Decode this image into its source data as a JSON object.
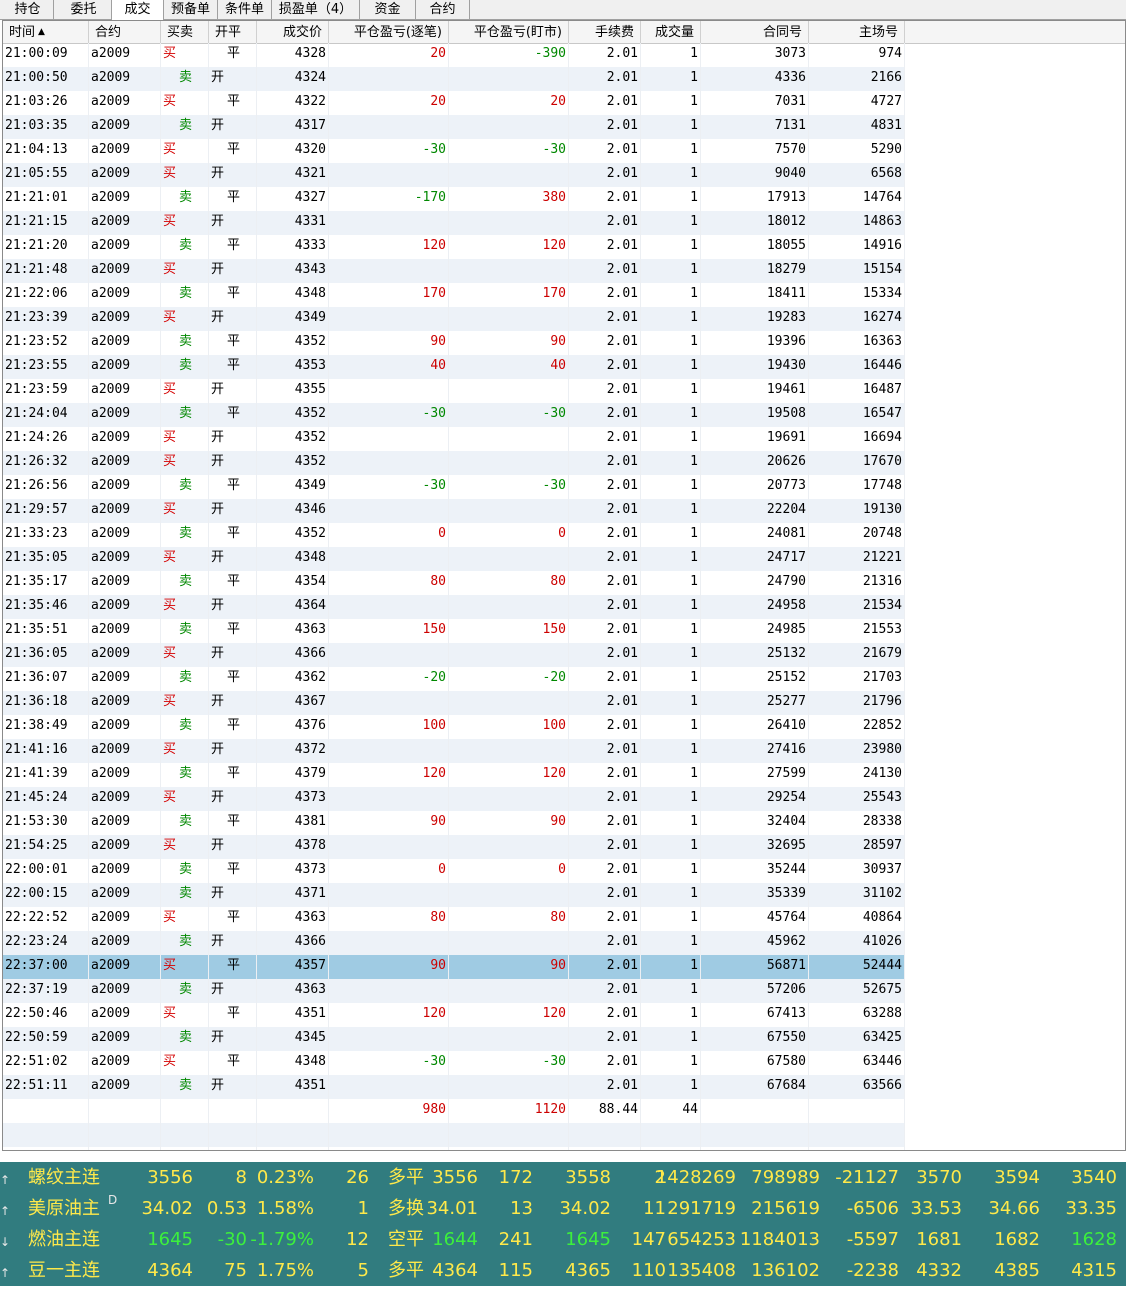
{
  "tabs": [
    {
      "label": "持仓",
      "active": false
    },
    {
      "label": "委托",
      "active": false
    },
    {
      "label": "成交",
      "active": true
    },
    {
      "label": "预备单",
      "active": false
    },
    {
      "label": "条件单",
      "active": false
    },
    {
      "label": "损盈单（4）",
      "active": false
    },
    {
      "label": "资金",
      "active": false
    },
    {
      "label": "合约",
      "active": false
    }
  ],
  "table": {
    "sort_indicator": "▲",
    "headers": {
      "time": "时间",
      "contract": "合约",
      "side": "买卖",
      "open_close": "开平",
      "price": "成交价",
      "pnl_trade": "平仓盈亏(逐笔)",
      "pnl_mtm": "平仓盈亏(盯市)",
      "fee": "手续费",
      "qty": "成交量",
      "contract_no": "合同号",
      "exchange_no": "主场号"
    },
    "rows": [
      {
        "time": "21:00:09",
        "contract": "a2009",
        "side": "买",
        "oc": "平",
        "price": "4328",
        "pnl_trade": "20",
        "pnl_mtm": "-390",
        "fee": "2.01",
        "qty": "1",
        "contract_no": "3073",
        "exchange_no": "974"
      },
      {
        "time": "21:00:50",
        "contract": "a2009",
        "side": "卖",
        "oc": "开",
        "price": "4324",
        "pnl_trade": "",
        "pnl_mtm": "",
        "fee": "2.01",
        "qty": "1",
        "contract_no": "4336",
        "exchange_no": "2166"
      },
      {
        "time": "21:03:26",
        "contract": "a2009",
        "side": "买",
        "oc": "平",
        "price": "4322",
        "pnl_trade": "20",
        "pnl_mtm": "20",
        "fee": "2.01",
        "qty": "1",
        "contract_no": "7031",
        "exchange_no": "4727"
      },
      {
        "time": "21:03:35",
        "contract": "a2009",
        "side": "卖",
        "oc": "开",
        "price": "4317",
        "pnl_trade": "",
        "pnl_mtm": "",
        "fee": "2.01",
        "qty": "1",
        "contract_no": "7131",
        "exchange_no": "4831"
      },
      {
        "time": "21:04:13",
        "contract": "a2009",
        "side": "买",
        "oc": "平",
        "price": "4320",
        "pnl_trade": "-30",
        "pnl_mtm": "-30",
        "fee": "2.01",
        "qty": "1",
        "contract_no": "7570",
        "exchange_no": "5290"
      },
      {
        "time": "21:05:55",
        "contract": "a2009",
        "side": "买",
        "oc": "开",
        "price": "4321",
        "pnl_trade": "",
        "pnl_mtm": "",
        "fee": "2.01",
        "qty": "1",
        "contract_no": "9040",
        "exchange_no": "6568"
      },
      {
        "time": "21:21:01",
        "contract": "a2009",
        "side": "卖",
        "oc": "平",
        "price": "4327",
        "pnl_trade": "-170",
        "pnl_mtm": "380",
        "fee": "2.01",
        "qty": "1",
        "contract_no": "17913",
        "exchange_no": "14764"
      },
      {
        "time": "21:21:15",
        "contract": "a2009",
        "side": "买",
        "oc": "开",
        "price": "4331",
        "pnl_trade": "",
        "pnl_mtm": "",
        "fee": "2.01",
        "qty": "1",
        "contract_no": "18012",
        "exchange_no": "14863"
      },
      {
        "time": "21:21:20",
        "contract": "a2009",
        "side": "卖",
        "oc": "平",
        "price": "4333",
        "pnl_trade": "120",
        "pnl_mtm": "120",
        "fee": "2.01",
        "qty": "1",
        "contract_no": "18055",
        "exchange_no": "14916"
      },
      {
        "time": "21:21:48",
        "contract": "a2009",
        "side": "买",
        "oc": "开",
        "price": "4343",
        "pnl_trade": "",
        "pnl_mtm": "",
        "fee": "2.01",
        "qty": "1",
        "contract_no": "18279",
        "exchange_no": "15154"
      },
      {
        "time": "21:22:06",
        "contract": "a2009",
        "side": "卖",
        "oc": "平",
        "price": "4348",
        "pnl_trade": "170",
        "pnl_mtm": "170",
        "fee": "2.01",
        "qty": "1",
        "contract_no": "18411",
        "exchange_no": "15334"
      },
      {
        "time": "21:23:39",
        "contract": "a2009",
        "side": "买",
        "oc": "开",
        "price": "4349",
        "pnl_trade": "",
        "pnl_mtm": "",
        "fee": "2.01",
        "qty": "1",
        "contract_no": "19283",
        "exchange_no": "16274"
      },
      {
        "time": "21:23:52",
        "contract": "a2009",
        "side": "卖",
        "oc": "平",
        "price": "4352",
        "pnl_trade": "90",
        "pnl_mtm": "90",
        "fee": "2.01",
        "qty": "1",
        "contract_no": "19396",
        "exchange_no": "16363"
      },
      {
        "time": "21:23:55",
        "contract": "a2009",
        "side": "卖",
        "oc": "平",
        "price": "4353",
        "pnl_trade": "40",
        "pnl_mtm": "40",
        "fee": "2.01",
        "qty": "1",
        "contract_no": "19430",
        "exchange_no": "16446"
      },
      {
        "time": "21:23:59",
        "contract": "a2009",
        "side": "买",
        "oc": "开",
        "price": "4355",
        "pnl_trade": "",
        "pnl_mtm": "",
        "fee": "2.01",
        "qty": "1",
        "contract_no": "19461",
        "exchange_no": "16487"
      },
      {
        "time": "21:24:04",
        "contract": "a2009",
        "side": "卖",
        "oc": "平",
        "price": "4352",
        "pnl_trade": "-30",
        "pnl_mtm": "-30",
        "fee": "2.01",
        "qty": "1",
        "contract_no": "19508",
        "exchange_no": "16547"
      },
      {
        "time": "21:24:26",
        "contract": "a2009",
        "side": "买",
        "oc": "开",
        "price": "4352",
        "pnl_trade": "",
        "pnl_mtm": "",
        "fee": "2.01",
        "qty": "1",
        "contract_no": "19691",
        "exchange_no": "16694"
      },
      {
        "time": "21:26:32",
        "contract": "a2009",
        "side": "买",
        "oc": "开",
        "price": "4352",
        "pnl_trade": "",
        "pnl_mtm": "",
        "fee": "2.01",
        "qty": "1",
        "contract_no": "20626",
        "exchange_no": "17670"
      },
      {
        "time": "21:26:56",
        "contract": "a2009",
        "side": "卖",
        "oc": "平",
        "price": "4349",
        "pnl_trade": "-30",
        "pnl_mtm": "-30",
        "fee": "2.01",
        "qty": "1",
        "contract_no": "20773",
        "exchange_no": "17748"
      },
      {
        "time": "21:29:57",
        "contract": "a2009",
        "side": "买",
        "oc": "开",
        "price": "4346",
        "pnl_trade": "",
        "pnl_mtm": "",
        "fee": "2.01",
        "qty": "1",
        "contract_no": "22204",
        "exchange_no": "19130"
      },
      {
        "time": "21:33:23",
        "contract": "a2009",
        "side": "卖",
        "oc": "平",
        "price": "4352",
        "pnl_trade": "0",
        "pnl_mtm": "0",
        "fee": "2.01",
        "qty": "1",
        "contract_no": "24081",
        "exchange_no": "20748"
      },
      {
        "time": "21:35:05",
        "contract": "a2009",
        "side": "买",
        "oc": "开",
        "price": "4348",
        "pnl_trade": "",
        "pnl_mtm": "",
        "fee": "2.01",
        "qty": "1",
        "contract_no": "24717",
        "exchange_no": "21221"
      },
      {
        "time": "21:35:17",
        "contract": "a2009",
        "side": "卖",
        "oc": "平",
        "price": "4354",
        "pnl_trade": "80",
        "pnl_mtm": "80",
        "fee": "2.01",
        "qty": "1",
        "contract_no": "24790",
        "exchange_no": "21316"
      },
      {
        "time": "21:35:46",
        "contract": "a2009",
        "side": "买",
        "oc": "开",
        "price": "4364",
        "pnl_trade": "",
        "pnl_mtm": "",
        "fee": "2.01",
        "qty": "1",
        "contract_no": "24958",
        "exchange_no": "21534"
      },
      {
        "time": "21:35:51",
        "contract": "a2009",
        "side": "卖",
        "oc": "平",
        "price": "4363",
        "pnl_trade": "150",
        "pnl_mtm": "150",
        "fee": "2.01",
        "qty": "1",
        "contract_no": "24985",
        "exchange_no": "21553"
      },
      {
        "time": "21:36:05",
        "contract": "a2009",
        "side": "买",
        "oc": "开",
        "price": "4366",
        "pnl_trade": "",
        "pnl_mtm": "",
        "fee": "2.01",
        "qty": "1",
        "contract_no": "25132",
        "exchange_no": "21679"
      },
      {
        "time": "21:36:07",
        "contract": "a2009",
        "side": "卖",
        "oc": "平",
        "price": "4362",
        "pnl_trade": "-20",
        "pnl_mtm": "-20",
        "fee": "2.01",
        "qty": "1",
        "contract_no": "25152",
        "exchange_no": "21703"
      },
      {
        "time": "21:36:18",
        "contract": "a2009",
        "side": "买",
        "oc": "开",
        "price": "4367",
        "pnl_trade": "",
        "pnl_mtm": "",
        "fee": "2.01",
        "qty": "1",
        "contract_no": "25277",
        "exchange_no": "21796"
      },
      {
        "time": "21:38:49",
        "contract": "a2009",
        "side": "卖",
        "oc": "平",
        "price": "4376",
        "pnl_trade": "100",
        "pnl_mtm": "100",
        "fee": "2.01",
        "qty": "1",
        "contract_no": "26410",
        "exchange_no": "22852"
      },
      {
        "time": "21:41:16",
        "contract": "a2009",
        "side": "买",
        "oc": "开",
        "price": "4372",
        "pnl_trade": "",
        "pnl_mtm": "",
        "fee": "2.01",
        "qty": "1",
        "contract_no": "27416",
        "exchange_no": "23980"
      },
      {
        "time": "21:41:39",
        "contract": "a2009",
        "side": "卖",
        "oc": "平",
        "price": "4379",
        "pnl_trade": "120",
        "pnl_mtm": "120",
        "fee": "2.01",
        "qty": "1",
        "contract_no": "27599",
        "exchange_no": "24130"
      },
      {
        "time": "21:45:24",
        "contract": "a2009",
        "side": "买",
        "oc": "开",
        "price": "4373",
        "pnl_trade": "",
        "pnl_mtm": "",
        "fee": "2.01",
        "qty": "1",
        "contract_no": "29254",
        "exchange_no": "25543"
      },
      {
        "time": "21:53:30",
        "contract": "a2009",
        "side": "卖",
        "oc": "平",
        "price": "4381",
        "pnl_trade": "90",
        "pnl_mtm": "90",
        "fee": "2.01",
        "qty": "1",
        "contract_no": "32404",
        "exchange_no": "28338"
      },
      {
        "time": "21:54:25",
        "contract": "a2009",
        "side": "买",
        "oc": "开",
        "price": "4378",
        "pnl_trade": "",
        "pnl_mtm": "",
        "fee": "2.01",
        "qty": "1",
        "contract_no": "32695",
        "exchange_no": "28597"
      },
      {
        "time": "22:00:01",
        "contract": "a2009",
        "side": "卖",
        "oc": "平",
        "price": "4373",
        "pnl_trade": "0",
        "pnl_mtm": "0",
        "fee": "2.01",
        "qty": "1",
        "contract_no": "35244",
        "exchange_no": "30937"
      },
      {
        "time": "22:00:15",
        "contract": "a2009",
        "side": "卖",
        "oc": "开",
        "price": "4371",
        "pnl_trade": "",
        "pnl_mtm": "",
        "fee": "2.01",
        "qty": "1",
        "contract_no": "35339",
        "exchange_no": "31102"
      },
      {
        "time": "22:22:52",
        "contract": "a2009",
        "side": "买",
        "oc": "平",
        "price": "4363",
        "pnl_trade": "80",
        "pnl_mtm": "80",
        "fee": "2.01",
        "qty": "1",
        "contract_no": "45764",
        "exchange_no": "40864"
      },
      {
        "time": "22:23:24",
        "contract": "a2009",
        "side": "卖",
        "oc": "开",
        "price": "4366",
        "pnl_trade": "",
        "pnl_mtm": "",
        "fee": "2.01",
        "qty": "1",
        "contract_no": "45962",
        "exchange_no": "41026"
      },
      {
        "time": "22:37:00",
        "contract": "a2009",
        "side": "买",
        "oc": "平",
        "price": "4357",
        "pnl_trade": "90",
        "pnl_mtm": "90",
        "fee": "2.01",
        "qty": "1",
        "contract_no": "56871",
        "exchange_no": "52444",
        "selected": true
      },
      {
        "time": "22:37:19",
        "contract": "a2009",
        "side": "卖",
        "oc": "开",
        "price": "4363",
        "pnl_trade": "",
        "pnl_mtm": "",
        "fee": "2.01",
        "qty": "1",
        "contract_no": "57206",
        "exchange_no": "52675"
      },
      {
        "time": "22:50:46",
        "contract": "a2009",
        "side": "买",
        "oc": "平",
        "price": "4351",
        "pnl_trade": "120",
        "pnl_mtm": "120",
        "fee": "2.01",
        "qty": "1",
        "contract_no": "67413",
        "exchange_no": "63288"
      },
      {
        "time": "22:50:59",
        "contract": "a2009",
        "side": "卖",
        "oc": "开",
        "price": "4345",
        "pnl_trade": "",
        "pnl_mtm": "",
        "fee": "2.01",
        "qty": "1",
        "contract_no": "67550",
        "exchange_no": "63425"
      },
      {
        "time": "22:51:02",
        "contract": "a2009",
        "side": "买",
        "oc": "平",
        "price": "4348",
        "pnl_trade": "-30",
        "pnl_mtm": "-30",
        "fee": "2.01",
        "qty": "1",
        "contract_no": "67580",
        "exchange_no": "63446"
      },
      {
        "time": "22:51:11",
        "contract": "a2009",
        "side": "卖",
        "oc": "开",
        "price": "4351",
        "pnl_trade": "",
        "pnl_mtm": "",
        "fee": "2.01",
        "qty": "1",
        "contract_no": "67684",
        "exchange_no": "63566"
      }
    ],
    "totals": {
      "pnl_trade": "980",
      "pnl_mtm": "1120",
      "fee": "88.44",
      "qty": "44"
    }
  },
  "quotes": [
    {
      "name": "螺纹主连",
      "sup": "",
      "last": "3556",
      "chg": "8",
      "pct": "0.23%",
      "vol": "26",
      "nature": "多平",
      "bid": "3556",
      "bid_vol": "172",
      "ask": "3558",
      "ask_vol": "2",
      "oi": "1428269",
      "prev_oi": "798989",
      "oi_chg": "-21127",
      "open": "3570",
      "high": "3594",
      "low": "3540",
      "dir": "up",
      "color": "y"
    },
    {
      "name": "美原油主",
      "sup": "D",
      "last": "34.02",
      "chg": "0.53",
      "pct": "1.58%",
      "vol": "1",
      "nature": "多换",
      "bid": "34.01",
      "bid_vol": "13",
      "ask": "34.02",
      "ask_vol": "11",
      "oi": "291719",
      "prev_oi": "215619",
      "oi_chg": "-6506",
      "open": "33.53",
      "high": "34.66",
      "low": "33.35",
      "dir": "up",
      "color": "y"
    },
    {
      "name": "燃油主连",
      "sup": "",
      "last": "1645",
      "chg": "-30",
      "pct": "-1.79%",
      "vol": "12",
      "nature": "空平",
      "bid": "1644",
      "bid_vol": "241",
      "ask": "1645",
      "ask_vol": "147",
      "oi": "654253",
      "prev_oi": "1184013",
      "oi_chg": "-5597",
      "open": "1681",
      "high": "1682",
      "low": "1628",
      "dir": "down",
      "color": "g"
    },
    {
      "name": "豆一主连",
      "sup": "",
      "last": "4364",
      "chg": "75",
      "pct": "1.75%",
      "vol": "5",
      "nature": "多平",
      "bid": "4364",
      "bid_vol": "115",
      "ask": "4365",
      "ask_vol": "110",
      "oi": "135408",
      "prev_oi": "136102",
      "oi_chg": "-2238",
      "open": "4332",
      "high": "4385",
      "low": "4315",
      "dir": "up",
      "color": "y"
    }
  ],
  "colors": {
    "positive": "#cc0000",
    "negative": "#008800",
    "selected_row": "#9fcbe3",
    "quote_panel_bg": "#317c7f",
    "quote_up": "#ffe94a",
    "quote_down": "#3cf03c"
  }
}
